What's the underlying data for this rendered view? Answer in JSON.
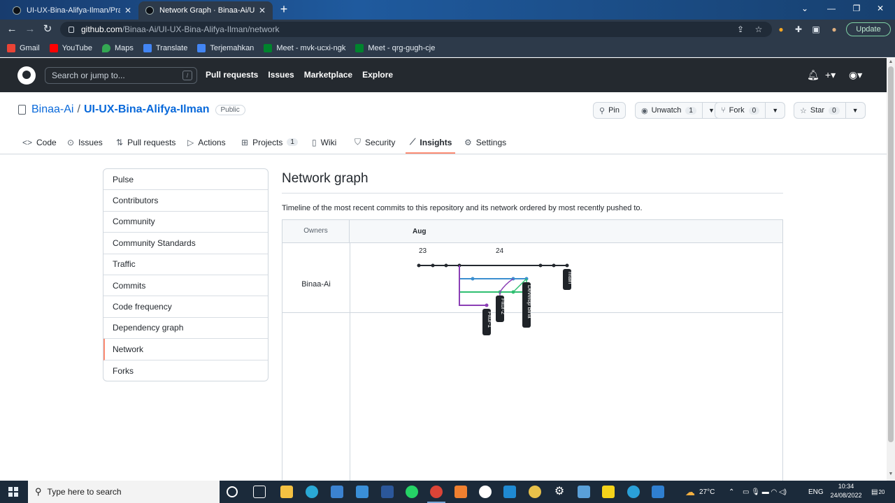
{
  "browser": {
    "tabs": [
      {
        "title": "UI-UX-Bina-Alifya-Ilman/Praktiku",
        "active": false
      },
      {
        "title": "Network Graph · Binaa-Ai/UI-UX",
        "active": true
      }
    ],
    "url_host": "github.com",
    "url_path": "/Binaa-Ai/UI-UX-Bina-Alifya-Ilman/network",
    "update_label": "Update",
    "bookmarks": [
      "Gmail",
      "YouTube",
      "Maps",
      "Translate",
      "Terjemahkan",
      "Meet - mvk-ucxi-ngk",
      "Meet - qrg-gugh-cje"
    ],
    "bookmark_colors": [
      "#ea4335",
      "#ff0000",
      "#34a853",
      "#4285f4",
      "#4285f4",
      "#00832d",
      "#00832d"
    ]
  },
  "gh_header": {
    "search_placeholder": "Search or jump to...",
    "search_key": "/",
    "nav": [
      "Pull requests",
      "Issues",
      "Marketplace",
      "Explore"
    ]
  },
  "repo": {
    "owner": "Binaa-Ai",
    "separator": "/",
    "name": "UI-UX-Bina-Alifya-Ilman",
    "visibility": "Public",
    "actions": {
      "pin": "Pin",
      "unwatch": "Unwatch",
      "unwatch_count": "1",
      "fork": "Fork",
      "fork_count": "0",
      "star": "Star",
      "star_count": "0"
    },
    "tabs": [
      {
        "label": "Code",
        "icon": "code-icon"
      },
      {
        "label": "Issues",
        "icon": "issue-icon"
      },
      {
        "label": "Pull requests",
        "icon": "pull-request-icon"
      },
      {
        "label": "Actions",
        "icon": "play-icon"
      },
      {
        "label": "Projects",
        "icon": "table-icon",
        "count": "1"
      },
      {
        "label": "Wiki",
        "icon": "book-icon"
      },
      {
        "label": "Security",
        "icon": "shield-icon"
      },
      {
        "label": "Insights",
        "icon": "graph-icon",
        "active": true
      },
      {
        "label": "Settings",
        "icon": "gear-icon"
      }
    ]
  },
  "sidebar": {
    "items": [
      "Pulse",
      "Contributors",
      "Community",
      "Community Standards",
      "Traffic",
      "Commits",
      "Code frequency",
      "Dependency graph",
      "Network",
      "Forks"
    ],
    "selected": "Network"
  },
  "main": {
    "title": "Network graph",
    "description": "Timeline of the most recent commits to this repository and its network ordered by most recently pushed to.",
    "owners_header": "Owners",
    "month": "Aug",
    "days": [
      "23",
      "24"
    ],
    "owner": "Binaa-Ai",
    "branches": [
      {
        "name": "main",
        "color": "#24292f"
      },
      {
        "name": "Develop Bina",
        "color": "#3b8fd0"
      },
      {
        "name": "Fitur-2",
        "color": "#2fbf71"
      },
      {
        "name": "Fitur-1",
        "color": "#8b3fb5"
      }
    ]
  },
  "taskbar": {
    "search_placeholder": "Type here to search",
    "weather": "27°C",
    "language": "ENG",
    "time": "10:34",
    "date": "24/08/2022",
    "notifications": "20"
  }
}
